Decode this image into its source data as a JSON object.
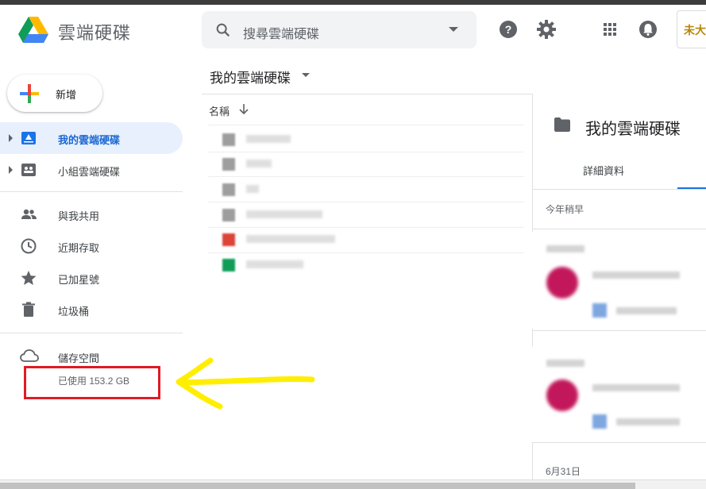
{
  "header": {
    "app_title": "雲端硬碟",
    "search_placeholder": "搜尋雲端硬碟",
    "avatar_text": "未大"
  },
  "sidebar": {
    "new_button": "新增",
    "items": [
      {
        "label": "我的雲端硬碟",
        "icon": "my-drive-icon",
        "active": true
      },
      {
        "label": "小組雲端硬碟",
        "icon": "shared-drives-icon",
        "active": false
      },
      {
        "label": "與我共用",
        "icon": "shared-with-me-icon",
        "active": false
      },
      {
        "label": "近期存取",
        "icon": "recent-icon",
        "active": false
      },
      {
        "label": "已加星號",
        "icon": "star-icon",
        "active": false
      },
      {
        "label": "垃圾桶",
        "icon": "trash-icon",
        "active": false
      }
    ],
    "storage_label": "儲存空間",
    "storage_used": "已使用 153.2 GB"
  },
  "main": {
    "breadcrumb": "我的雲端硬碟",
    "column_name": "名稱"
  },
  "details": {
    "title": "我的雲端硬碟",
    "tab_details": "詳細資料",
    "recent_label": "今年稍早",
    "date_label": "6月31日"
  },
  "colors": {
    "accent": "#1a73e8",
    "active_bg": "#e8f0fe",
    "highlight_red": "#e01b24",
    "annotation_yellow": "#ffee00"
  }
}
